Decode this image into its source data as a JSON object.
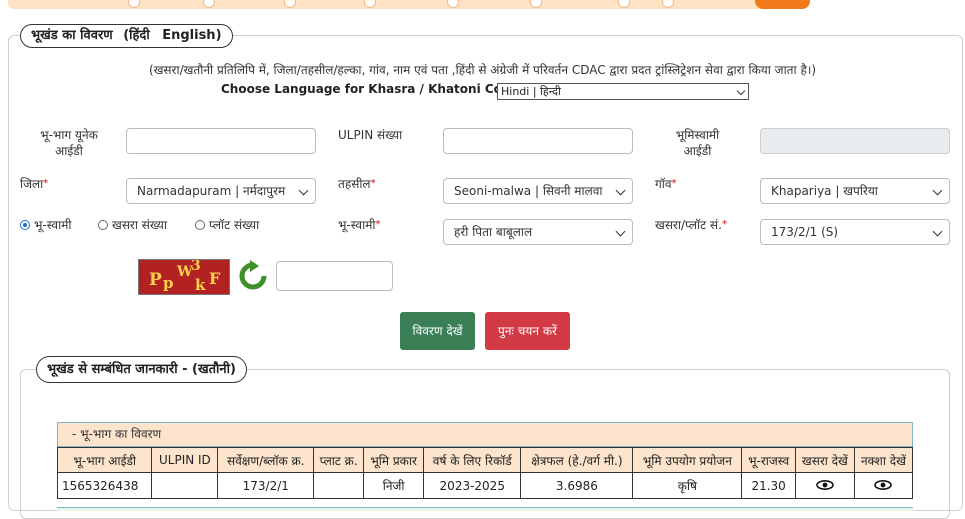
{
  "section1": {
    "legend_hi": "भूखंड का विवरण",
    "legend_hindi": "(हिंदी",
    "legend_en": "English)",
    "note": "(खसरा/खतौनी प्रतिलिपि में, जिला/तहसील/हल्का, गांव, नाम एवं पता ,हिंदी से अंग्रेजी में परिवर्तन CDAC द्वारा प्रदत ट्रांस्लिट्रेशन सेवा द्वारा किया जाता है।)",
    "choose_label": "Choose Language for Khasra / Khatoni Copy:",
    "language_value": "Hindi | हिन्दी"
  },
  "form": {
    "unique_id_label_1": "भू-भाग  यूनेक",
    "unique_id_label_2": "आईडी",
    "ulpin_label": "ULPIN संख्या",
    "owner_id_label_1": "भूमिस्वामी",
    "owner_id_label_2": "आईडी",
    "district_label": "जिला",
    "district_value": "Narmadapuram | नर्मदापुरम",
    "tehsil_label": "तहसील",
    "tehsil_value": "Seoni-malwa | सिवनी मालवा",
    "village_label": "गॉव",
    "village_value": "Khapariya | खपरिया",
    "radio_owner": "भू-स्वामी",
    "radio_khasra": "खसरा संख्या",
    "radio_plot": "प्लॉट संख्या",
    "owner_label": "भू-स्वामी",
    "owner_value": "हरी पिता बाबूलाल",
    "khasra_label": "खसरा/प्लॉट सं.",
    "khasra_value": "173/2/1 (S)",
    "required_mark": "*"
  },
  "captcha": {
    "text": [
      "P",
      "p",
      "W",
      "3",
      "k",
      "F"
    ]
  },
  "buttons": {
    "view_details": "विवरण देखें",
    "reselect": "पुनः चयन करें"
  },
  "section2": {
    "legend": "भूखंड से सम्बंधित जानकारी -   (खतौनी)",
    "table_title": "- भू-भाग का विवरण",
    "columns": [
      "भू-भाग आईडी",
      "ULPIN ID",
      "सर्वेक्षण/ब्लॉक क्र.",
      "प्लाट क्र.",
      "भूमि प्रकार",
      "वर्ष के लिए रिकॉर्ड",
      "क्षेत्रफल (हे./वर्ग मी.)",
      "भूमि उपयोग प्रयोजन",
      "भू-राजस्व",
      "खसरा देखें",
      "नक्शा देखें"
    ],
    "row": {
      "land_id": "1565326438",
      "ulpin": "",
      "survey": "173/2/1",
      "plot": "",
      "land_type": "निजी",
      "year": "2023-2025",
      "area": "3.6986",
      "use": "कृषि",
      "revenue": "21.30"
    }
  },
  "colors": {
    "accent_orange": "#f07a1a",
    "green_button": "#3a7f56",
    "red_button": "#d23a45",
    "table_header": "#fde4cc"
  }
}
